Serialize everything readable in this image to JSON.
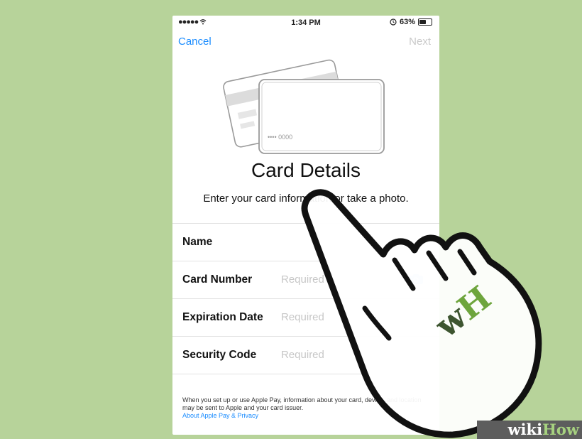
{
  "status_bar": {
    "carrier": "●●●●● ",
    "time": "1:34 PM",
    "battery": "63%",
    "battery_level": 0.63
  },
  "nav": {
    "cancel": "Cancel",
    "next": "Next"
  },
  "card_illustration": {
    "card_number_hint": "•••• 0000"
  },
  "title": "Card Details",
  "subtitle": "Enter your card information or take a photo.",
  "form": {
    "rows": [
      {
        "label": "Name",
        "value": "",
        "placeholder": ""
      },
      {
        "label": "Card Number",
        "value": "",
        "placeholder": "Required"
      },
      {
        "label": "Expiration Date",
        "value": "",
        "placeholder": "Required"
      },
      {
        "label": "Security Code",
        "value": "",
        "placeholder": "Required"
      }
    ]
  },
  "footer": {
    "text": "When you set up or use Apple Pay, information about your card, device, and location may be sent to Apple and your card issuer.",
    "link": "About Apple Pay & Privacy"
  },
  "watermark": {
    "logo": "wH",
    "wiki": "wiki",
    "how": "How"
  },
  "colors": {
    "background": "#b7d39a",
    "ios_blue": "#1a8cff",
    "logo_green": "#6ea53d",
    "logo_dark": "#3d5530"
  },
  "icons": [
    "wifi-icon",
    "alarm-icon",
    "battery-icon",
    "camera-icon",
    "hand-pointer-icon"
  ]
}
